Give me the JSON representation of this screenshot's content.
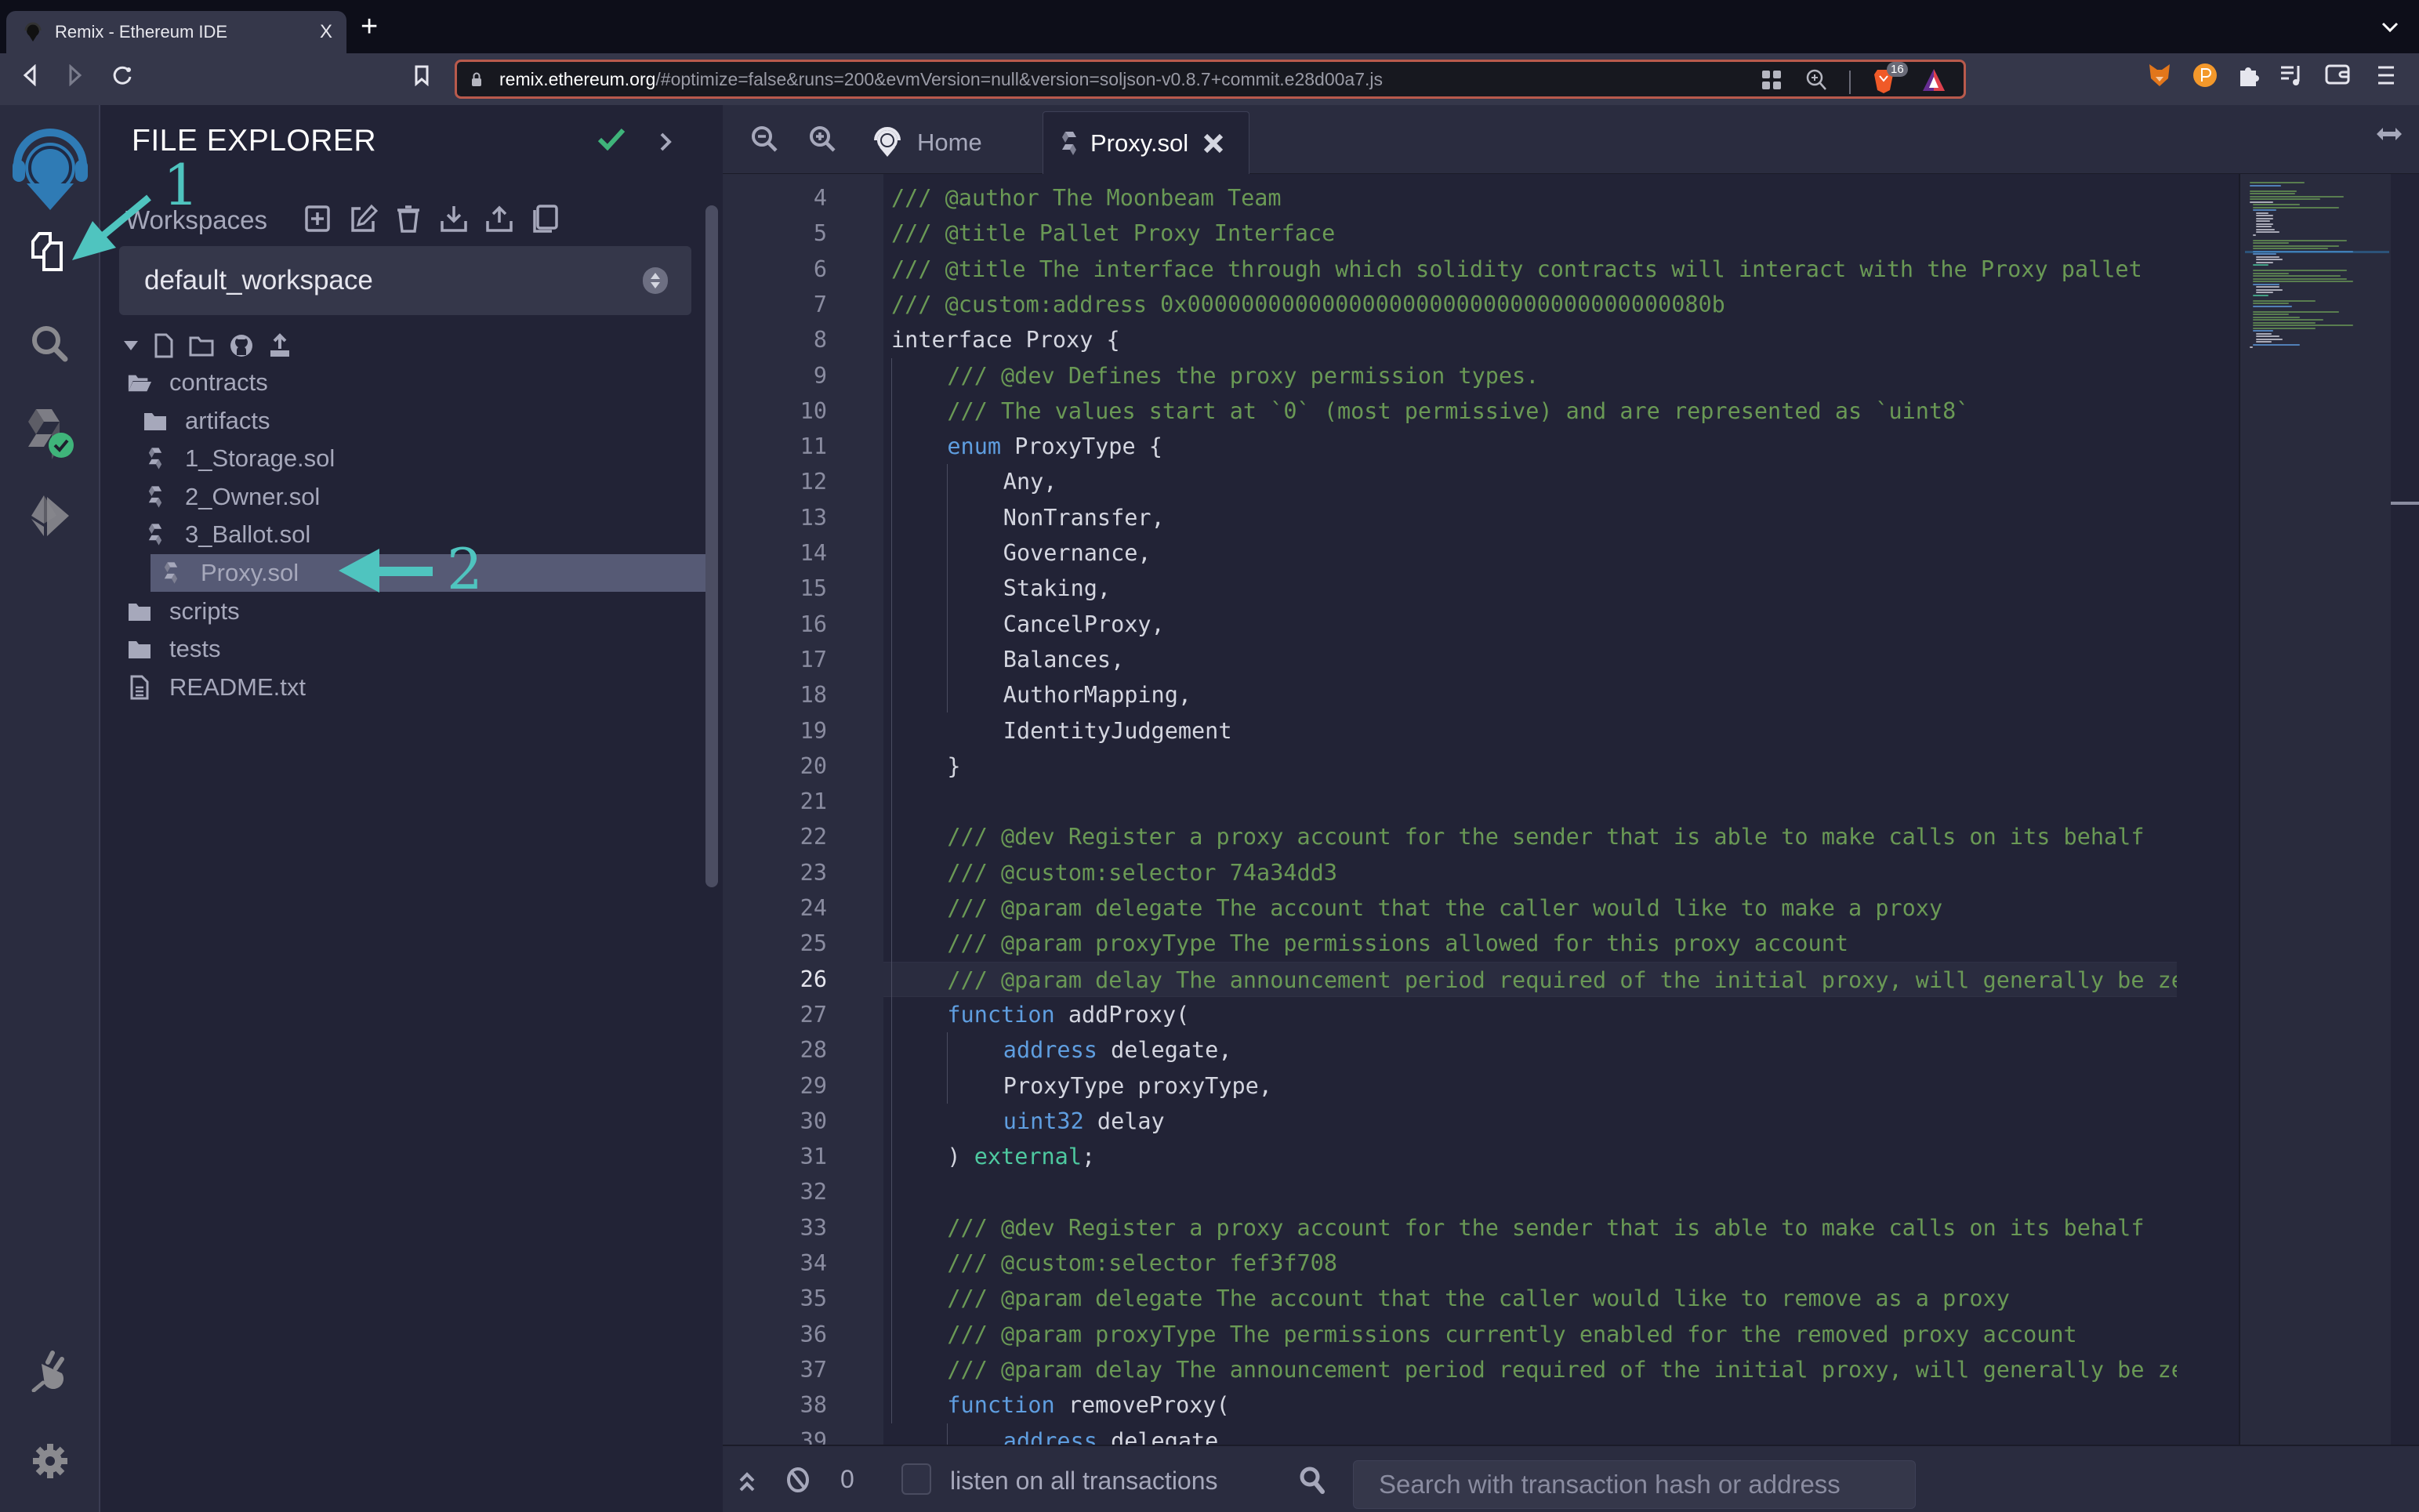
{
  "browser": {
    "tab_title": "Remix - Ethereum IDE",
    "new_tab": "+",
    "tab_close": "X",
    "tab_menu": "⌄",
    "url_host": "remix.ethereum.org",
    "url_path": "/#optimize=false&runs=200&evmVersion=null&version=soljson-v0.8.7+commit.e28d00a7.js",
    "brave_shield_count": "16"
  },
  "icon_bar": {
    "items": [
      "home-logo",
      "file-explorer",
      "search",
      "solidity-compiler",
      "deploy-run",
      "plugin-manager",
      "settings"
    ]
  },
  "explorer": {
    "title": "FILE EXPLORER",
    "workspaces_label": "Workspaces",
    "workspace_value": "default_workspace",
    "tree": [
      {
        "name": "contracts",
        "type": "folder-open",
        "depth": 0
      },
      {
        "name": "artifacts",
        "type": "folder",
        "depth": 1
      },
      {
        "name": "1_Storage.sol",
        "type": "solidity",
        "depth": 1
      },
      {
        "name": "2_Owner.sol",
        "type": "solidity",
        "depth": 1
      },
      {
        "name": "3_Ballot.sol",
        "type": "solidity",
        "depth": 1
      },
      {
        "name": "Proxy.sol",
        "type": "solidity",
        "depth": 1,
        "selected": true
      },
      {
        "name": "scripts",
        "type": "folder",
        "depth": 0
      },
      {
        "name": "tests",
        "type": "folder",
        "depth": 0
      },
      {
        "name": "README.txt",
        "type": "file",
        "depth": 0
      }
    ]
  },
  "annotations": {
    "step1": "1",
    "step2": "2",
    "color": "#4fc4bf"
  },
  "editor": {
    "tabs": [
      {
        "label": "Home",
        "active": false
      },
      {
        "label": "Proxy.sol",
        "active": true
      }
    ],
    "current_line": 26,
    "lines": [
      {
        "n": 4,
        "indent": 0,
        "tokens": [
          [
            "com",
            "/// @author The Moonbeam Team"
          ]
        ]
      },
      {
        "n": 5,
        "indent": 0,
        "tokens": [
          [
            "com",
            "/// @title Pallet Proxy Interface"
          ]
        ]
      },
      {
        "n": 6,
        "indent": 0,
        "tokens": [
          [
            "com",
            "/// @title The interface through which solidity contracts will interact with the Proxy pallet"
          ]
        ]
      },
      {
        "n": 7,
        "indent": 0,
        "tokens": [
          [
            "com",
            "/// @custom:address 0x000000000000000000000000000000000000080b"
          ]
        ]
      },
      {
        "n": 8,
        "indent": 0,
        "tokens": [
          [
            "txt",
            "interface Proxy {"
          ]
        ]
      },
      {
        "n": 9,
        "indent": 1,
        "tokens": [
          [
            "com",
            "/// @dev Defines the proxy permission types."
          ]
        ]
      },
      {
        "n": 10,
        "indent": 1,
        "tokens": [
          [
            "com",
            "/// The values start at `0` (most permissive) and are represented as `uint8`"
          ]
        ]
      },
      {
        "n": 11,
        "indent": 1,
        "tokens": [
          [
            "kw",
            "enum"
          ],
          [
            "txt",
            " ProxyType {"
          ]
        ]
      },
      {
        "n": 12,
        "indent": 2,
        "tokens": [
          [
            "txt",
            "Any,"
          ]
        ]
      },
      {
        "n": 13,
        "indent": 2,
        "tokens": [
          [
            "txt",
            "NonTransfer,"
          ]
        ]
      },
      {
        "n": 14,
        "indent": 2,
        "tokens": [
          [
            "txt",
            "Governance,"
          ]
        ]
      },
      {
        "n": 15,
        "indent": 2,
        "tokens": [
          [
            "txt",
            "Staking,"
          ]
        ]
      },
      {
        "n": 16,
        "indent": 2,
        "tokens": [
          [
            "txt",
            "CancelProxy,"
          ]
        ]
      },
      {
        "n": 17,
        "indent": 2,
        "tokens": [
          [
            "txt",
            "Balances,"
          ]
        ]
      },
      {
        "n": 18,
        "indent": 2,
        "tokens": [
          [
            "txt",
            "AuthorMapping,"
          ]
        ]
      },
      {
        "n": 19,
        "indent": 2,
        "tokens": [
          [
            "txt",
            "IdentityJudgement"
          ]
        ]
      },
      {
        "n": 20,
        "indent": 1,
        "tokens": [
          [
            "txt",
            "}"
          ]
        ]
      },
      {
        "n": 21,
        "indent": 0,
        "tokens": []
      },
      {
        "n": 22,
        "indent": 1,
        "tokens": [
          [
            "com",
            "/// @dev Register a proxy account for the sender that is able to make calls on its behalf"
          ]
        ]
      },
      {
        "n": 23,
        "indent": 1,
        "tokens": [
          [
            "com",
            "/// @custom:selector 74a34dd3"
          ]
        ]
      },
      {
        "n": 24,
        "indent": 1,
        "tokens": [
          [
            "com",
            "/// @param delegate The account that the caller would like to make a proxy"
          ]
        ]
      },
      {
        "n": 25,
        "indent": 1,
        "tokens": [
          [
            "com",
            "/// @param proxyType The permissions allowed for this proxy account"
          ]
        ]
      },
      {
        "n": 26,
        "indent": 1,
        "tokens": [
          [
            "com",
            "/// @param delay The announcement period required of the initial proxy, will generally be zero"
          ]
        ]
      },
      {
        "n": 27,
        "indent": 1,
        "tokens": [
          [
            "kw",
            "function"
          ],
          [
            "txt",
            " addProxy("
          ]
        ]
      },
      {
        "n": 28,
        "indent": 2,
        "tokens": [
          [
            "kw",
            "address"
          ],
          [
            "txt",
            " delegate,"
          ]
        ]
      },
      {
        "n": 29,
        "indent": 2,
        "tokens": [
          [
            "txt",
            "ProxyType proxyType,"
          ]
        ]
      },
      {
        "n": 30,
        "indent": 2,
        "tokens": [
          [
            "kw",
            "uint32"
          ],
          [
            "txt",
            " delay"
          ]
        ]
      },
      {
        "n": 31,
        "indent": 1,
        "tokens": [
          [
            "txt",
            ") "
          ],
          [
            "ext",
            "external"
          ],
          [
            "txt",
            ";"
          ]
        ]
      },
      {
        "n": 32,
        "indent": 0,
        "tokens": []
      },
      {
        "n": 33,
        "indent": 1,
        "tokens": [
          [
            "com",
            "/// @dev Register a proxy account for the sender that is able to make calls on its behalf"
          ]
        ]
      },
      {
        "n": 34,
        "indent": 1,
        "tokens": [
          [
            "com",
            "/// @custom:selector fef3f708"
          ]
        ]
      },
      {
        "n": 35,
        "indent": 1,
        "tokens": [
          [
            "com",
            "/// @param delegate The account that the caller would like to remove as a proxy"
          ]
        ]
      },
      {
        "n": 36,
        "indent": 1,
        "tokens": [
          [
            "com",
            "/// @param proxyType The permissions currently enabled for the removed proxy account"
          ]
        ]
      },
      {
        "n": 37,
        "indent": 1,
        "tokens": [
          [
            "com",
            "/// @param delay The announcement period required of the initial proxy, will generally be zero"
          ]
        ]
      },
      {
        "n": 38,
        "indent": 1,
        "tokens": [
          [
            "kw",
            "function"
          ],
          [
            "txt",
            " removeProxy("
          ]
        ]
      },
      {
        "n": 39,
        "indent": 2,
        "tokens": [
          [
            "kw",
            "address"
          ],
          [
            "txt",
            " delegate,"
          ]
        ]
      }
    ]
  },
  "terminal": {
    "count": "0",
    "listen_label": "listen on all transactions",
    "listen_checked": false,
    "search_placeholder": "Search with transaction hash or address"
  },
  "colors": {
    "comment": "#6a9955",
    "keyword": "#5f9ee0",
    "external": "#4ec9a0",
    "text": "#d4d6e0",
    "remix_blue": "#2f7bb5",
    "success_green": "#3fb47a"
  }
}
